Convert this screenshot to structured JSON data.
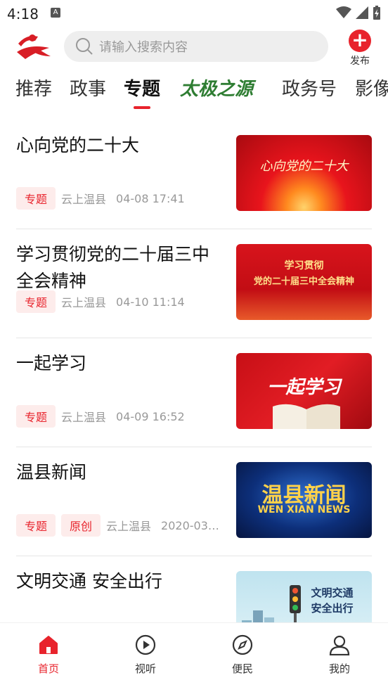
{
  "status_bar": {
    "time": "4:18"
  },
  "header": {
    "search_placeholder": "请输入搜索内容",
    "publish_label": "发布"
  },
  "tabs": [
    {
      "label": "推荐"
    },
    {
      "label": "政事"
    },
    {
      "label": "专题",
      "active": true
    },
    {
      "label": "太极之源"
    },
    {
      "label": "政务号"
    },
    {
      "label": "影像"
    }
  ],
  "feed": [
    {
      "title": "心向党的二十大",
      "tags": [
        "专题"
      ],
      "source": "云上温县",
      "time": "04-08 17:41",
      "thumb_text": "心向党的二十大"
    },
    {
      "title": "学习贯彻党的二十届三中全会精神",
      "tags": [
        "专题"
      ],
      "source": "云上温县",
      "time": "04-10 11:14",
      "thumb_text_1": "学习贯彻",
      "thumb_text_2": "党的二十届三中全会精神"
    },
    {
      "title": "一起学习",
      "tags": [
        "专题"
      ],
      "source": "云上温县",
      "time": "04-09 16:52",
      "thumb_text": "一起学习"
    },
    {
      "title": "温县新闻",
      "tags": [
        "专题",
        "原创"
      ],
      "source": "云上温县",
      "time": "2020-03…",
      "thumb_text_1": "温县新闻",
      "thumb_text_2": "WEN XIAN NEWS"
    },
    {
      "title": "文明交通 安全出行",
      "tags": [],
      "source": "",
      "time": "",
      "thumb_text_1": "文明交通",
      "thumb_text_2": "安全出行"
    }
  ],
  "bottom_nav": [
    {
      "label": "首页",
      "icon": "home-icon",
      "active": true
    },
    {
      "label": "视听",
      "icon": "play-icon"
    },
    {
      "label": "便民",
      "icon": "compass-icon"
    },
    {
      "label": "我的",
      "icon": "user-icon"
    }
  ],
  "colors": {
    "accent": "#e8232c"
  }
}
